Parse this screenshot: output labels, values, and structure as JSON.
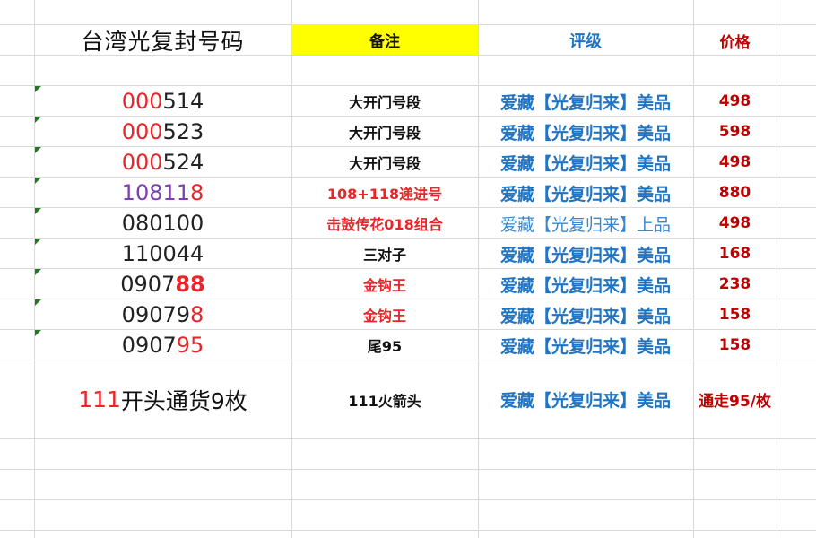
{
  "header": {
    "title": "台湾光复封号码",
    "remark_label": "备注",
    "grade_label": "评级",
    "price_label": "价格"
  },
  "rows": [
    {
      "num_a": "000",
      "num_b": "514",
      "remark": "大开门号段",
      "grade": "爱藏【光复归来】美品",
      "price": "498"
    },
    {
      "num_a": "000",
      "num_b": "523",
      "remark": "大开门号段",
      "grade": "爱藏【光复归来】美品",
      "price": "598"
    },
    {
      "num_a": "000",
      "num_b": "524",
      "remark": "大开门号段",
      "grade": "爱藏【光复归来】美品",
      "price": "498"
    },
    {
      "num_a": "10811",
      "num_b": "8",
      "remark": "108+118递进号",
      "grade": "爱藏【光复归来】美品",
      "price": "880"
    },
    {
      "num_a": "080100",
      "num_b": "",
      "remark": "击鼓传花018组合",
      "grade": "爱藏【光复归来】上品",
      "price": "498"
    },
    {
      "num_a": "110044",
      "num_b": "",
      "remark": "三对子",
      "grade": "爱藏【光复归来】美品",
      "price": "168"
    },
    {
      "num_a": "0907",
      "num_b": "88",
      "remark": "金钩王",
      "grade": "爱藏【光复归来】美品",
      "price": "238"
    },
    {
      "num_a": "09079",
      "num_b": "8",
      "remark": "金钩王",
      "grade": "爱藏【光复归来】美品",
      "price": "158"
    },
    {
      "num_a": "0907",
      "num_b": "95",
      "remark": "尾95",
      "grade": "爱藏【光复归来】美品",
      "price": "158"
    }
  ],
  "footer": {
    "num_a": "111",
    "num_b": "开头通货9枚",
    "remark": "111火箭头",
    "grade": "爱藏【光复归来】美品",
    "price": "通走95/枚"
  },
  "colors": {
    "grid": "#d9d9d9",
    "header_fill": "#ffff00",
    "grade_blue": "#1f74c4",
    "price_red": "#c00000",
    "number_red": "#e8262a",
    "number_purple": "#7a3fb2",
    "comment_marker_green": "#1e7a1e"
  }
}
